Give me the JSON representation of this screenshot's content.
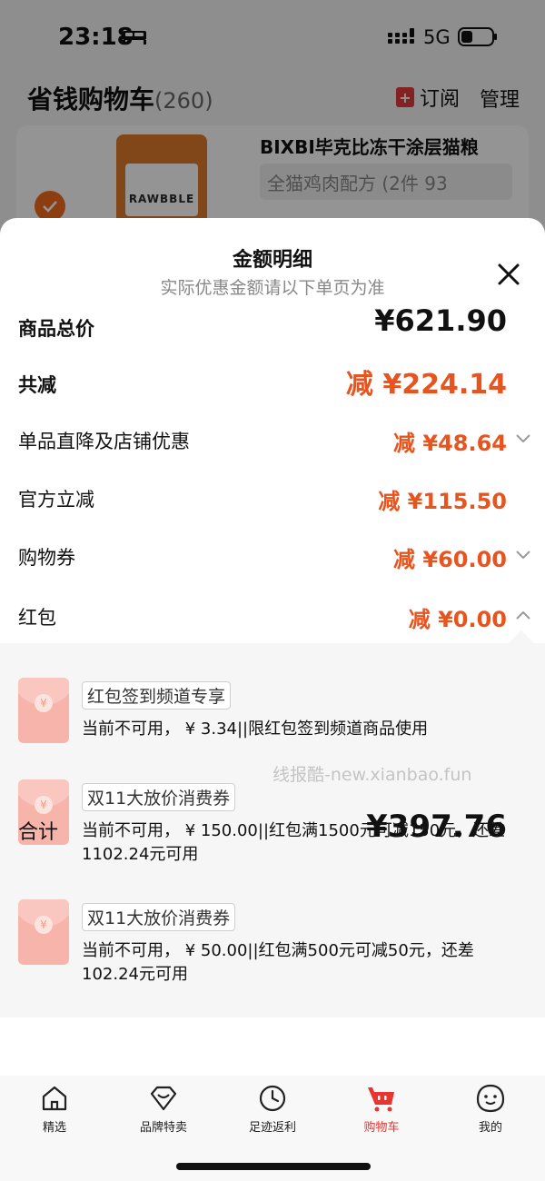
{
  "status_bar": {
    "time": "23:18",
    "network": "5G"
  },
  "cart": {
    "title": "省钱购物车",
    "count": "(260)",
    "subscribe_label": "订阅",
    "manage_label": "管理",
    "product": {
      "name": "BIXBI毕克比冻干涂层猫粮",
      "spec": "全猫鸡肉配方 (2件 93",
      "brand": "RAWBBLE"
    }
  },
  "sheet": {
    "title": "金额明细",
    "subtitle": "实际优惠金额请以下单页为准",
    "rows": [
      {
        "label": "商品总价",
        "value": "¥621.90"
      },
      {
        "label": "共减",
        "value": "减 ¥224.14"
      },
      {
        "label": "单品直降及店铺优惠",
        "value": "减 ¥48.64"
      },
      {
        "label": "官方立减",
        "value": "减 ¥115.50"
      },
      {
        "label": "购物券",
        "value": "减 ¥60.00"
      },
      {
        "label": "红包",
        "value": "减 ¥0.00"
      }
    ],
    "coupons": [
      {
        "tag": "红包签到频道专享",
        "desc": "当前不可用， ¥ 3.34||限红包签到频道商品使用"
      },
      {
        "tag": "双11大放价消费券",
        "desc": "当前不可用， ¥ 150.00||红包满1500元可减150元，还差1102.24元可用"
      },
      {
        "tag": "双11大放价消费券",
        "desc": "当前不可用， ¥ 50.00||红包满500元可减50元，还差102.24元可用"
      }
    ],
    "watermark": "线报酷-new.xianbao.fun",
    "total_label": "合计",
    "total_value": "¥397.76"
  },
  "tabbar": {
    "tabs": [
      {
        "label": "精选"
      },
      {
        "label": "品牌特卖"
      },
      {
        "label": "足迹返利"
      },
      {
        "label": "购物车"
      },
      {
        "label": "我的"
      }
    ]
  },
  "colors": {
    "accent": "#e8541e",
    "tab_active": "#e8352f",
    "check": "#f26b1c"
  }
}
